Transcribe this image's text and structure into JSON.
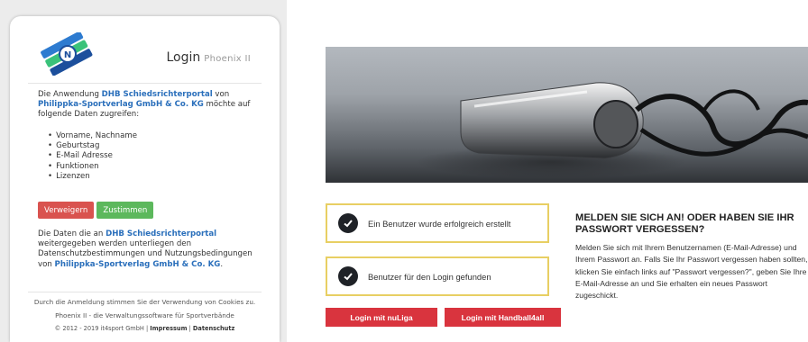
{
  "login_card": {
    "title": "Login",
    "subtitle": "Phoenix II",
    "intro_1": "Die Anwendung ",
    "app_name": "DHB Schiedsrichterportal",
    "intro_2": " von ",
    "publisher": "Philippka-Sportverlag GmbH & Co. KG",
    "intro_3": " möchte auf folgende Daten zugreifen:",
    "data_items": [
      "Vorname, Nachname",
      "Geburtstag",
      "E-Mail Adresse",
      "Funktionen",
      "Lizenzen"
    ],
    "deny_label": "Verweigern",
    "accept_label": "Zustimmen",
    "privacy_1": "Die Daten die an ",
    "privacy_2": " weitergegeben werden unterliegen den Datenschutzbestimmungen und Nutzungsbedingungen von ",
    "privacy_3": ".",
    "footer_cookies": "Durch die Anmeldung stimmen Sie der Verwendung von Cookies zu.",
    "footer_software": "Phoenix II - die Verwaltungssoftware für Sportverbände",
    "footer_copyright": "© 2012 - 2019 it4sport GmbH | ",
    "footer_impressum": "Impressum",
    "footer_sep": " | ",
    "footer_datenschutz": "Datenschutz"
  },
  "right": {
    "status_1": "Ein Benutzer wurde erfolgreich erstellt",
    "status_2": "Benutzer für den Login gefunden",
    "btn_nuliga": "Login mit nuLiga",
    "btn_handball": "Login mit Handball4all",
    "heading_line1": "MELDEN SIE SICH AN! ODER HABEN SIE IHR",
    "heading_line2": "PASSWORT VERGESSEN?",
    "body_text": "Melden Sie sich mit Ihrem Benutzernamen (E-Mail-Adresse) und Ihrem Passwort an. Falls Sie Ihr Passwort vergessen haben sollten, klicken Sie einfach links auf \"Passwort vergessen?\", geben Sie Ihre E-Mail-Adresse an und Sie erhalten ein neues Passwort zugeschickt."
  },
  "colors": {
    "link_blue": "#2a6fbb",
    "deny_red": "#d9534f",
    "accept_green": "#5cb85c",
    "status_border": "#e8cf63",
    "login_red": "#d9343e"
  },
  "icons": {
    "logo": "dhb-logo-icon",
    "check": "check-circle-icon",
    "hero": "whistle-photo"
  }
}
